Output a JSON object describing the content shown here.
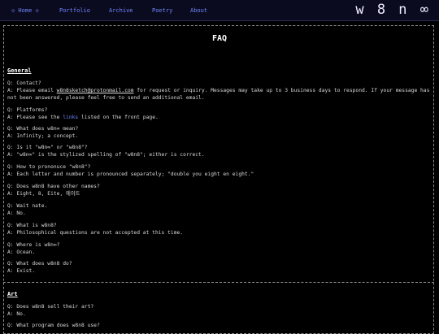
{
  "nav": {
    "home": "◇ Home ◇",
    "portfolio": "Portfolio",
    "archive": "Archive",
    "poetry": "Poetry",
    "about": "About",
    "brand": "w 8 n ∞"
  },
  "page_title": "FAQ",
  "general": {
    "heading": "General",
    "q1": "Q: Contact?",
    "a1_pre": "A: Please email ",
    "a1_email": "w8n8sketch@protonmail.com",
    "a1_post": " for request or inquiry. Messages may take up to 3 business days to respond. If your message has not been answered, please feel free to send an additional email.",
    "q2": "Q: Platforms?",
    "a2_pre": "A: Please see the ",
    "a2_link": "links",
    "a2_post": " listed on the front page.",
    "q3": "Q: What does w8n∞ mean?",
    "a3": "A: Infinity; a concept.",
    "q4": "Q: Is it \"w8n∞\" or \"w8n8\"?",
    "a4": "A: \"w8n∞\" is the stylized spelling of \"w8n8\"; either is correct.",
    "q5": "Q: How to prononuce \"w8n8\"?",
    "a5": "A: Each letter and number is pronounced separately; \"double you eight en eight.\"",
    "q6": "Q: Does w8n8 have other names?",
    "a6": "A: Eight, 8, Eite, 에이트",
    "q7": "Q: Wait nate.",
    "a7": "A: No.",
    "q8": "Q: What is w8n8?",
    "a8": "A: Philosophical questions are not accepted at this time.",
    "q9": "Q: Where is w8n∞?",
    "a9": "A: Ocean.",
    "q10": "Q: What does w8n8 do?",
    "a10": "A: Exist."
  },
  "art": {
    "heading": "Art",
    "q1": "Q: Does w8n8 sell their art?",
    "a1": "A: No.",
    "q2": "Q: What program does w8n8 use?"
  }
}
